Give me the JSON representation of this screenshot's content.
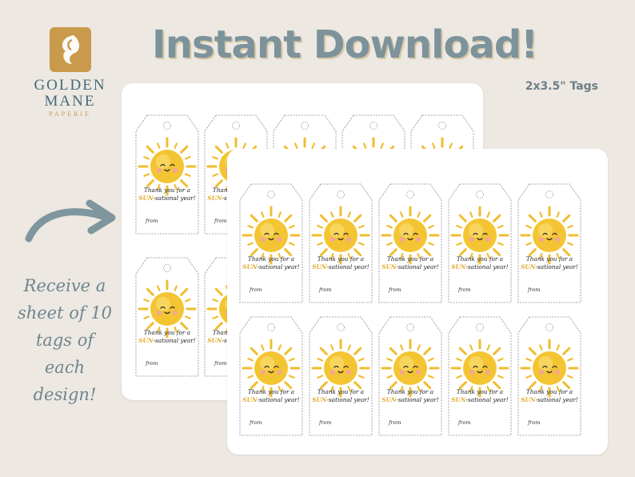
{
  "brand": {
    "line1": "GOLDEN",
    "line2": "MANE",
    "line3": "PAPERIE",
    "logo_icon": "golden-mane-logo-icon",
    "accent": "#c99a4b",
    "ink": "#456b7c"
  },
  "headline": "Instant Download!",
  "subheadline": "2x3.5\" Tags",
  "side_note": [
    "Receive a",
    "sheet of 10",
    "tags of",
    "each",
    "design!"
  ],
  "tag": {
    "line1": "Thank you for a",
    "sun_word": "SUN",
    "line2_rest": "-sational year!",
    "from_label": "from"
  },
  "colors": {
    "background": "#ede8e2",
    "headline": "#7d939b",
    "sun": "#f3c431",
    "sun_word": "#e5a82a",
    "arrow": "#7f969e"
  },
  "sheets": [
    {
      "name": "back-sheet",
      "tag_count": 10
    },
    {
      "name": "front-sheet",
      "tag_count": 10
    }
  ]
}
